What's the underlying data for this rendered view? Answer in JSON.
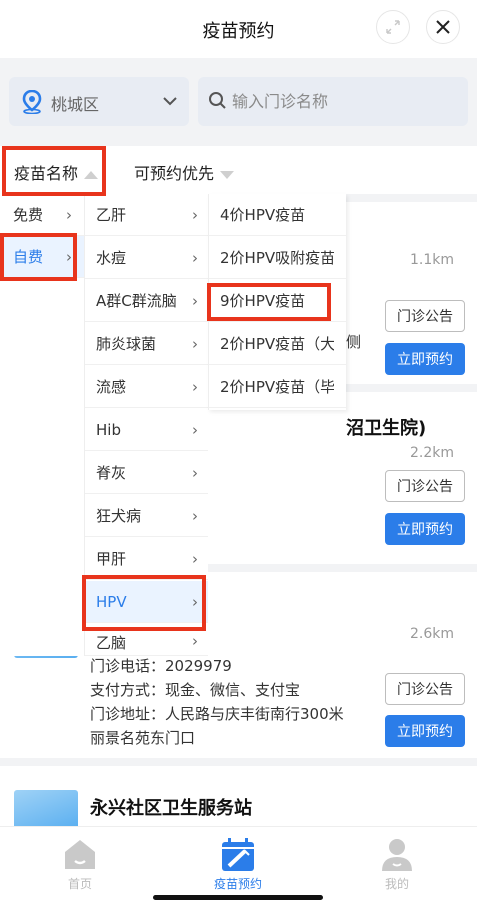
{
  "header": {
    "title": "疫苗预约"
  },
  "search": {
    "district": "桃城区",
    "placeholder": "输入门诊名称"
  },
  "filters": {
    "vaccine_name": "疫苗名称",
    "priority": "可预约优先"
  },
  "dropdown": {
    "fee_types": [
      {
        "label": "免费",
        "arrow": "›"
      },
      {
        "label": "自费",
        "arrow": "›"
      }
    ],
    "categories": [
      {
        "label": "乙肝",
        "arrow": "›"
      },
      {
        "label": "水痘",
        "arrow": "›"
      },
      {
        "label": "A群C群流脑",
        "arrow": "›"
      },
      {
        "label": "肺炎球菌",
        "arrow": "›"
      },
      {
        "label": "流感",
        "arrow": "›"
      },
      {
        "label": "Hib",
        "arrow": "›"
      },
      {
        "label": "脊灰",
        "arrow": "›"
      },
      {
        "label": "狂犬病",
        "arrow": "›"
      },
      {
        "label": "甲肝",
        "arrow": "›"
      },
      {
        "label": "HPV",
        "arrow": "›"
      },
      {
        "label": "乙脑",
        "arrow": "›"
      }
    ],
    "vaccines": [
      {
        "label": "4价HPV疫苗"
      },
      {
        "label": "2价HPV吸附疫苗"
      },
      {
        "label": "9价HPV疫苗"
      },
      {
        "label": "2价HPV疫苗（大"
      },
      {
        "label": "2价HPV疫苗（毕"
      }
    ]
  },
  "clinics": [
    {
      "distance": "1.1km",
      "notice_label": "门诊公告",
      "book_label": "立即预约",
      "partial_text": "侧"
    },
    {
      "title_partial": "沼卫生院)",
      "distance": "2.2km",
      "notice_label": "门诊公告",
      "book_label": "立即预约"
    },
    {
      "distance": "2.6km",
      "phone": "门诊电话：2029979",
      "payment": "支付方式：现金、微信、支付宝",
      "address_line1": "门诊地址：人民路与庆丰街南行300米",
      "address_line2": "丽景名苑东门口",
      "notice_label": "门诊公告",
      "book_label": "立即预约"
    },
    {
      "title": "永兴社区卫生服务站"
    }
  ],
  "tabs": {
    "home": "首页",
    "vaccine": "疫苗预约",
    "me": "我的"
  },
  "colors": {
    "accent": "#2b7de9",
    "highlight": "#e8341c",
    "background": "#f2f3f5"
  }
}
